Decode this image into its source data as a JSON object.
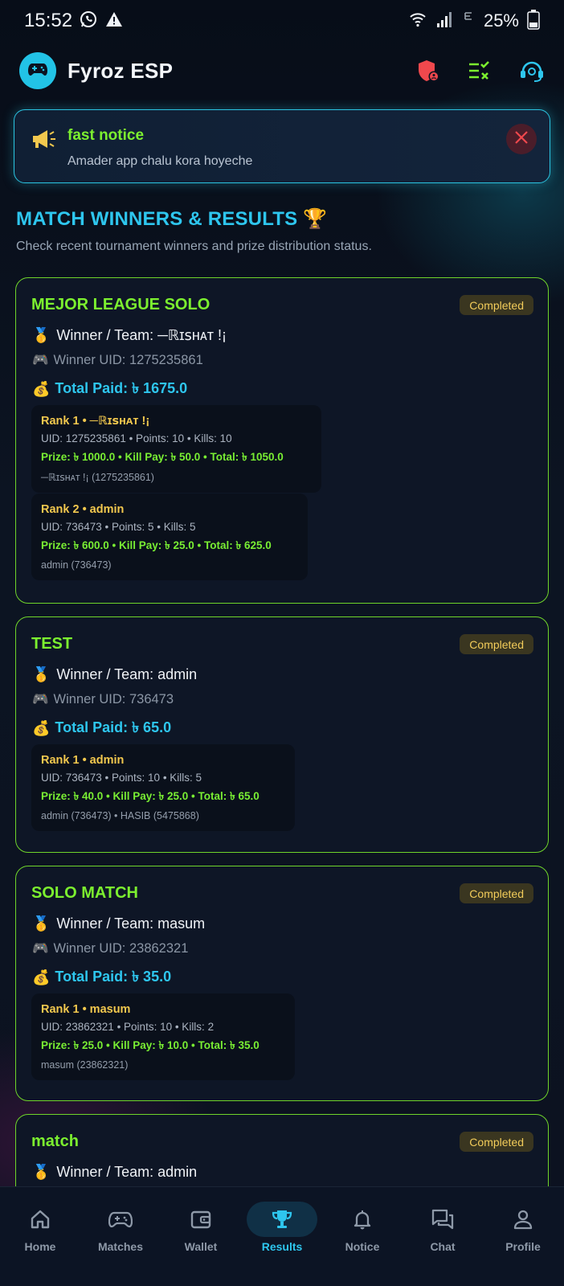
{
  "status_bar": {
    "time": "15:52",
    "battery": "25%"
  },
  "header": {
    "title": "Fyroz ESP"
  },
  "notice": {
    "title": "fast notice",
    "body": "Amader app chalu kora hoyeche"
  },
  "section": {
    "title": "MATCH WINNERS & RESULTS 🏆",
    "subtitle": "Check recent tournament winners and prize distribution status."
  },
  "matches": [
    {
      "title": "MEJOR LEAGUE SOLO",
      "status": "Completed",
      "winner": "Winner / Team: ─ℝɪꜱʜᴀᴛ !¡",
      "uid": "Winner UID: 1275235861",
      "paid": "Total Paid: ৳ 1675.0",
      "ranks": [
        {
          "title": "Rank 1 • ─ℝɪꜱʜᴀᴛ !¡",
          "uid_line": "UID: 1275235861  •  Points: 10  •  Kills: 10",
          "prize_line": "Prize: ৳ 1000.0  •  Kill Pay: ৳ 50.0  •  Total: ৳ 1050.0",
          "members": "─ℝɪꜱʜᴀᴛ !¡ (1275235861)"
        },
        {
          "title": "Rank 2 • admin",
          "uid_line": "UID: 736473  •  Points: 5  •  Kills: 5",
          "prize_line": "Prize: ৳ 600.0  •  Kill Pay: ৳ 25.0  •  Total: ৳ 625.0",
          "members": "admin (736473)"
        }
      ]
    },
    {
      "title": "TEST",
      "status": "Completed",
      "winner": "Winner / Team: admin",
      "uid": "Winner UID: 736473",
      "paid": "Total Paid: ৳ 65.0",
      "ranks": [
        {
          "title": "Rank 1 • admin",
          "uid_line": "UID: 736473  •  Points: 10  •  Kills: 5",
          "prize_line": "Prize: ৳ 40.0  •  Kill Pay: ৳ 25.0  •  Total: ৳ 65.0",
          "members": "admin (736473) • HASIB (5475868)"
        }
      ]
    },
    {
      "title": "SOLO MATCH",
      "status": "Completed",
      "winner": "Winner / Team: masum",
      "uid": "Winner UID: 23862321",
      "paid": "Total Paid: ৳ 35.0",
      "ranks": [
        {
          "title": "Rank 1 • masum",
          "uid_line": "UID: 23862321  •  Points: 10  •  Kills: 2",
          "prize_line": "Prize: ৳ 25.0  •  Kill Pay: ৳ 10.0  •  Total: ৳ 35.0",
          "members": "masum (23862321)"
        }
      ]
    },
    {
      "title": "match",
      "status": "Completed",
      "winner": "Winner / Team: admin"
    }
  ],
  "nav": [
    {
      "label": "Home",
      "icon": "home-icon"
    },
    {
      "label": "Matches",
      "icon": "gamepad-icon"
    },
    {
      "label": "Wallet",
      "icon": "wallet-icon"
    },
    {
      "label": "Results",
      "icon": "trophy-icon",
      "active": true
    },
    {
      "label": "Notice",
      "icon": "bell-icon"
    },
    {
      "label": "Chat",
      "icon": "chat-icon"
    },
    {
      "label": "Profile",
      "icon": "person-icon"
    }
  ],
  "colors": {
    "accent_cyan": "#2ec6ee",
    "accent_green": "#7cf02f",
    "rank_gold": "#f2c84e",
    "background": "#0b1220"
  }
}
